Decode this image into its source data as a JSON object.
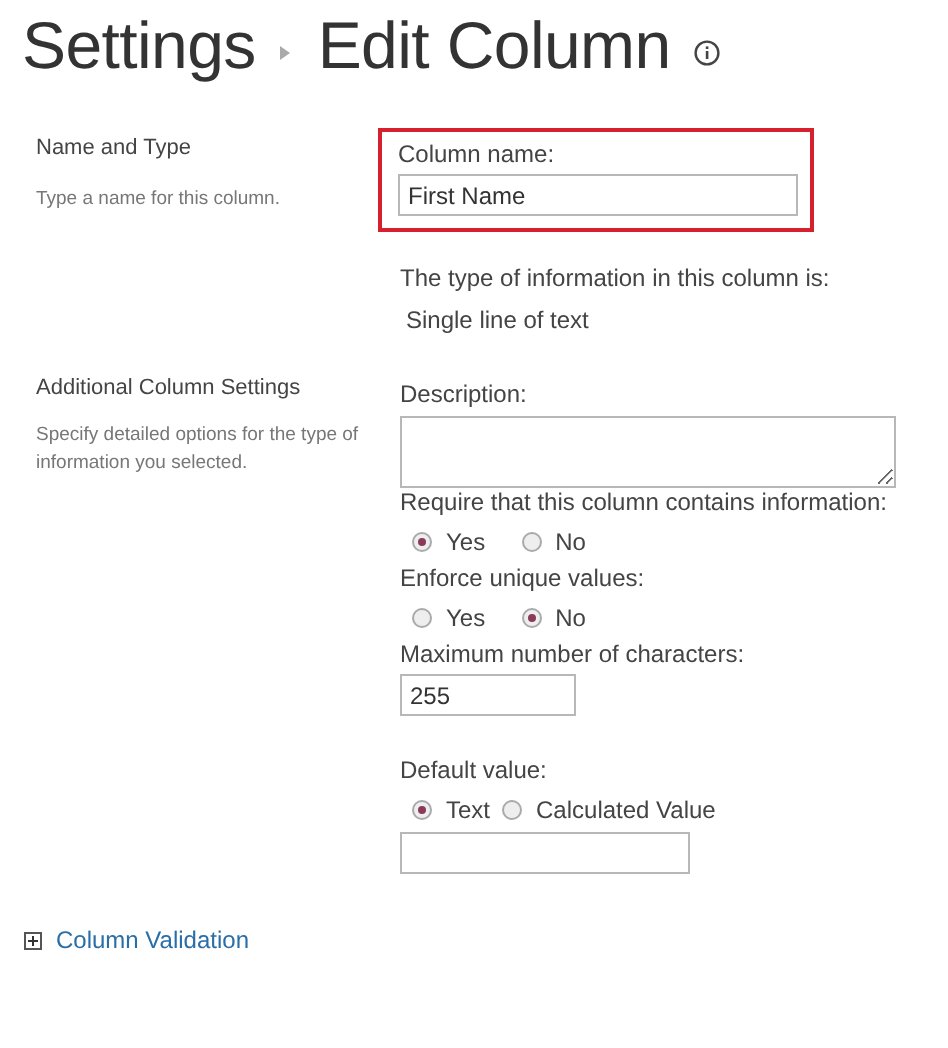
{
  "header": {
    "breadcrumb": "Settings",
    "title": "Edit Column"
  },
  "sections": [
    {
      "heading": "Name and Type",
      "description": "Type a name for this column."
    },
    {
      "heading": "Additional Column Settings",
      "description": "Specify detailed options for the type of information you selected."
    }
  ],
  "column_name": {
    "label": "Column name:",
    "value": "First Name",
    "highlighted": true
  },
  "type_info": {
    "label": "The type of information in this column is:",
    "value": "Single line of text"
  },
  "description": {
    "label": "Description:"
  },
  "require": {
    "label": "Require that this column contains information:",
    "options": [
      {
        "label": "Yes",
        "selected": true
      },
      {
        "label": "No",
        "selected": false
      }
    ]
  },
  "unique": {
    "label": "Enforce unique values:",
    "options": [
      {
        "label": "Yes",
        "selected": false
      },
      {
        "label": "No",
        "selected": true
      }
    ]
  },
  "max_chars": {
    "label": "Maximum number of characters:",
    "value": "255"
  },
  "default_value": {
    "label": "Default value:",
    "options": [
      {
        "label": "Text",
        "selected": true
      },
      {
        "label": "Calculated Value",
        "selected": false
      }
    ]
  },
  "column_validation": {
    "label": "Column Validation",
    "expanded": false
  }
}
